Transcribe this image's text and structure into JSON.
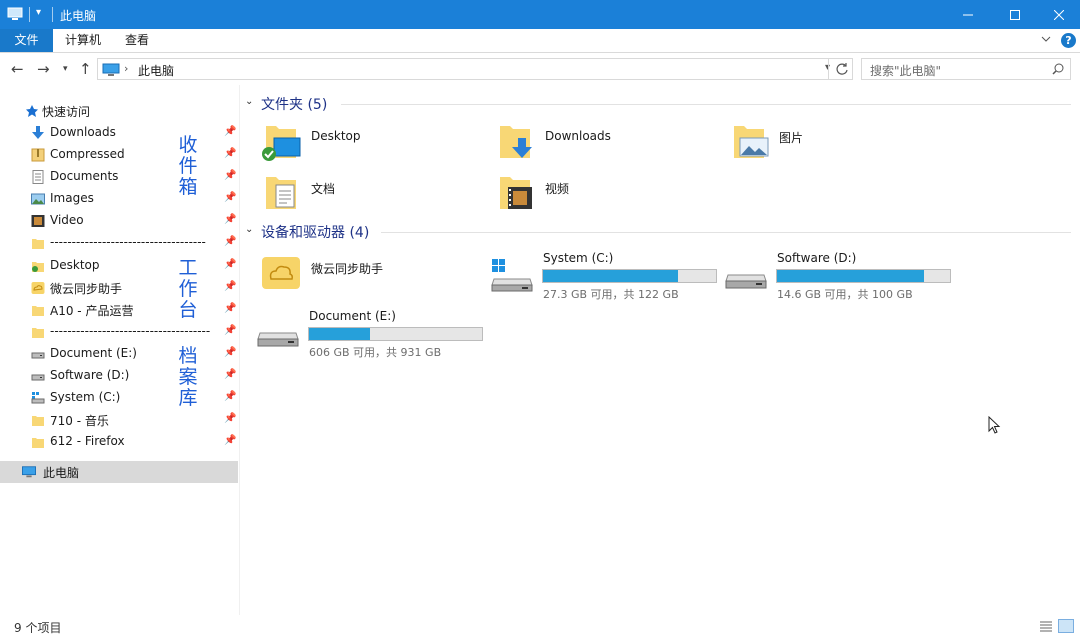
{
  "window": {
    "title": "此电脑",
    "accent": "#1b80d8"
  },
  "ribbon": {
    "tabs": [
      "文件",
      "计算机",
      "查看"
    ]
  },
  "nav": {
    "address": "此电脑",
    "search_placeholder": "搜索\"此电脑\""
  },
  "sidebar": {
    "quick_access": "快速访问",
    "items": [
      {
        "label": "Downloads",
        "icon": "download-arrow-icon"
      },
      {
        "label": "Compressed",
        "icon": "archive-icon"
      },
      {
        "label": "Documents",
        "icon": "document-icon"
      },
      {
        "label": "Images",
        "icon": "image-icon"
      },
      {
        "label": "Video",
        "icon": "video-icon"
      },
      {
        "label": "------------------------------------",
        "icon": "folder-icon"
      },
      {
        "label": "Desktop",
        "icon": "desktop-folder-icon"
      },
      {
        "label": "微云同步助手",
        "icon": "cloud-sync-icon"
      },
      {
        "label": "A10 - 产品运营",
        "icon": "folder-icon"
      },
      {
        "label": "-------------------------------------",
        "icon": "folder-icon"
      },
      {
        "label": "Document (E:)",
        "icon": "drive-icon"
      },
      {
        "label": "Software (D:)",
        "icon": "drive-icon"
      },
      {
        "label": "System (C:)",
        "icon": "system-drive-icon"
      },
      {
        "label": "710 - 音乐",
        "icon": "folder-icon"
      },
      {
        "label": "612 - Firefox",
        "icon": "folder-icon"
      }
    ],
    "this_pc": "此电脑",
    "notes": [
      "收件箱",
      "工作台",
      "档案库"
    ]
  },
  "main": {
    "folders_header": "文件夹 (5)",
    "folders": [
      "Desktop",
      "Downloads",
      "图片",
      "文档",
      "视频"
    ],
    "devices_header": "设备和驱动器 (4)",
    "cloud_app": "微云同步助手",
    "drives": [
      {
        "name": "System (C:)",
        "free": "27.3 GB 可用，共 122 GB",
        "used_fraction": 0.78
      },
      {
        "name": "Software (D:)",
        "free": "14.6 GB 可用，共 100 GB",
        "used_fraction": 0.85
      },
      {
        "name": "Document (E:)",
        "free": "606 GB 可用，共 931 GB",
        "used_fraction": 0.35
      }
    ]
  },
  "status": {
    "count": "9 个项目"
  }
}
